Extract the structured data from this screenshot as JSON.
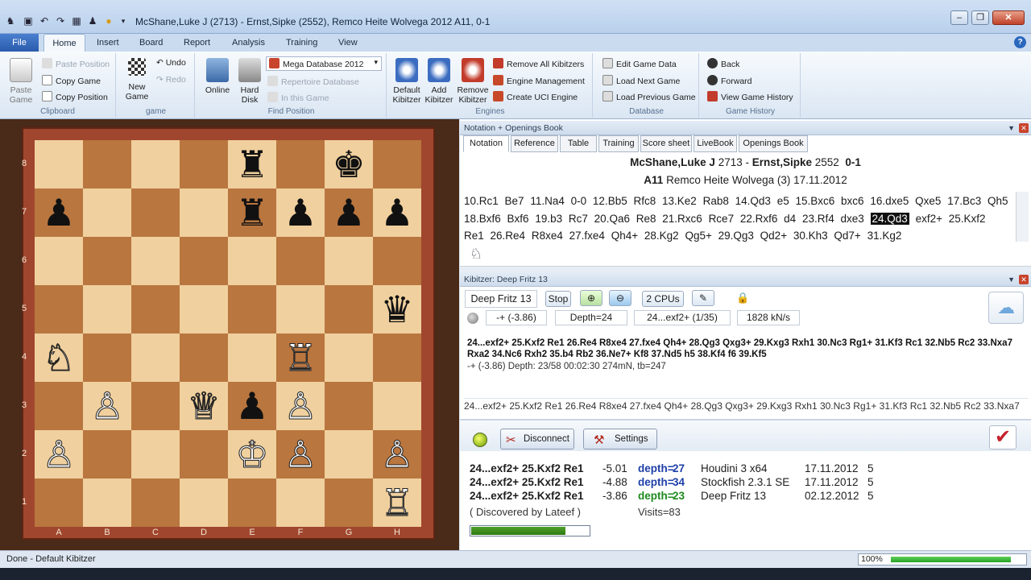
{
  "titlebar": {
    "title": "McShane,Luke J (2713) - Ernst,Sipke (2552), Remco Heite Wolvega 2012  A11, 0-1"
  },
  "tabs": [
    "File",
    "Home",
    "Insert",
    "Board",
    "Report",
    "Analysis",
    "Training",
    "View"
  ],
  "ribbon": {
    "clipboard": {
      "paste_game": "Paste\nGame",
      "paste_position": "Paste Position",
      "copy_game": "Copy Game",
      "copy_position": "Copy Position",
      "label": "Clipboard"
    },
    "game": {
      "new_game": "New\nGame",
      "undo": "Undo",
      "redo": "Redo",
      "label": "game"
    },
    "find": {
      "online": "Online",
      "hard_disk": "Hard\nDisk",
      "database_select": "Mega Database 2012",
      "repertoire": "Repertoire Database",
      "in_this_game": "In this Game",
      "label": "Find Position"
    },
    "engines": {
      "default_kibitzer": "Default\nKibitzer",
      "add_kibitzer": "Add\nKibitzer",
      "remove_kibitzer": "Remove\nKibitzer",
      "remove_all": "Remove All Kibitzers",
      "engine_mgmt": "Engine Management",
      "create_uci": "Create UCI Engine",
      "label": "Engines"
    },
    "database": {
      "edit_game": "Edit Game Data",
      "load_next": "Load Next Game",
      "load_prev": "Load Previous Game",
      "label": "Database"
    },
    "history": {
      "back": "Back",
      "forward": "Forward",
      "view_history": "View Game History",
      "label": "Game History"
    }
  },
  "board": {
    "ranks": [
      "8",
      "7",
      "6",
      "5",
      "4",
      "3",
      "2",
      "1"
    ],
    "files": [
      "A",
      "B",
      "C",
      "D",
      "E",
      "F",
      "G",
      "H"
    ],
    "pieces": [
      {
        "sq": "e8",
        "glyph": "♜",
        "color": "b"
      },
      {
        "sq": "g8",
        "glyph": "♚",
        "color": "b"
      },
      {
        "sq": "a7",
        "glyph": "♟",
        "color": "b"
      },
      {
        "sq": "e7",
        "glyph": "♜",
        "color": "b"
      },
      {
        "sq": "f7",
        "glyph": "♟",
        "color": "b"
      },
      {
        "sq": "g7",
        "glyph": "♟",
        "color": "b"
      },
      {
        "sq": "h7",
        "glyph": "♟",
        "color": "b"
      },
      {
        "sq": "h5",
        "glyph": "♛",
        "color": "b"
      },
      {
        "sq": "a4",
        "glyph": "♘",
        "color": "w"
      },
      {
        "sq": "f4",
        "glyph": "♖",
        "color": "w"
      },
      {
        "sq": "b3",
        "glyph": "♙",
        "color": "w"
      },
      {
        "sq": "d3",
        "glyph": "♕",
        "color": "w"
      },
      {
        "sq": "e3",
        "glyph": "♟",
        "color": "b"
      },
      {
        "sq": "f3",
        "glyph": "♙",
        "color": "w"
      },
      {
        "sq": "a2",
        "glyph": "♙",
        "color": "w"
      },
      {
        "sq": "e2",
        "glyph": "♔",
        "color": "w"
      },
      {
        "sq": "f2",
        "glyph": "♙",
        "color": "w"
      },
      {
        "sq": "h2",
        "glyph": "♙",
        "color": "w"
      },
      {
        "sq": "h1",
        "glyph": "♖",
        "color": "w"
      }
    ]
  },
  "notation_panel": {
    "title": "Notation + Openings Book",
    "tabs": [
      "Notation",
      "Reference",
      "Table",
      "Training",
      "Score sheet",
      "LiveBook",
      "Openings Book"
    ],
    "white_player": "McShane,Luke J",
    "white_elo": "2713",
    "black_player": "Ernst,Sipke",
    "black_elo": "2552",
    "result": "0-1",
    "eco": "A11",
    "event": "Remco Heite Wolvega (3) 17.11.2012",
    "moves": [
      "10.Rc1",
      "Be7",
      "11.Na4",
      "0-0",
      "12.Bb5",
      "Rfc8",
      "13.Ke2",
      "Rab8",
      "14.Qd3",
      "e5",
      "15.Bxc6",
      "bxc6",
      "16.dxe5",
      "Qxe5",
      "17.Bc3",
      "Qh5",
      "18.Bxf6",
      "Bxf6",
      "19.b3",
      "Rc7",
      "20.Qa6",
      "Re8",
      "21.Rxc6",
      "Rce7",
      "22.Rxf6",
      "d4",
      "23.Rf4",
      "dxe3",
      "24.Qd3",
      "exf2+",
      "25.Kxf2",
      "Re1",
      "26.Re4",
      "R8xe4",
      "27.fxe4",
      "Qh4+",
      "28.Kg2",
      "Qg5+",
      "29.Qg3",
      "Qd2+",
      "30.Kh3",
      "Qd7+",
      "31.Kg2"
    ],
    "current_move": "24.Qd3"
  },
  "kibitzer": {
    "title": "Kibitzer: Deep Fritz 13",
    "engine": "Deep Fritz 13",
    "stop": "Stop",
    "cpus": "2 CPUs",
    "eval": "-+  (-3.86)",
    "depth": "Depth=24",
    "move": "24...exf2+ (1/35)",
    "speed": "1828 kN/s",
    "mainline": "24...exf2+ 25.Kxf2 Re1 26.Re4 R8xe4 27.fxe4 Qh4+ 28.Qg3 Qxg3+ 29.Kxg3 Rxh1 30.Nc3 Rg1+ 31.Kf3 Rc1 32.Nb5 Rc2 33.Nxa7 Rxa2 34.Nc6 Rxh2 35.b4 Rb2 36.Ne7+ Kf8 37.Nd5 h5 38.Kf4 f6 39.Kf5",
    "info": "-+  (-3.86)   Depth: 23/58   00:02:30  274mN, tb=247",
    "line": "24...exf2+ 25.Kxf2 Re1 26.Re4 R8xe4 27.fxe4 Qh4+ 28.Qg3 Qxg3+ 29.Kxg3 Rxh1 30.Nc3 Rg1+ 31.Kf3 Rc1 32.Nb5 Rc2 33.Nxa7"
  },
  "cloud": {
    "disconnect": "Disconnect",
    "settings": "Settings",
    "rows": [
      {
        "line": "24...exf2+ 25.Kxf2 Re1",
        "eval": "-5.01",
        "depth_label": "depth=",
        "depth": "27",
        "engine": "Houdini 3 x64",
        "date": "17.11.2012",
        "n": "5",
        "color": "#1d3fa8"
      },
      {
        "line": "24...exf2+ 25.Kxf2 Re1",
        "eval": "-4.88",
        "depth_label": "depth=",
        "depth": "34",
        "engine": "Stockfish 2.3.1 SE",
        "date": "17.11.2012",
        "n": "5",
        "color": "#1d3fa8"
      },
      {
        "line": "24...exf2+ 25.Kxf2 Re1",
        "eval": "-3.86",
        "depth_label": "depth=",
        "depth": "23",
        "engine": "Deep Fritz 13",
        "date": "02.12.2012",
        "n": "5",
        "color": "#1e8a1e"
      }
    ],
    "discovered": "( Discovered by Lateef )",
    "visits": "Visits=83",
    "visits_fill": 0.8
  },
  "status": {
    "text": "Done - Default Kibitzer",
    "zoom": "100%",
    "zoom_fill": 0.9
  }
}
